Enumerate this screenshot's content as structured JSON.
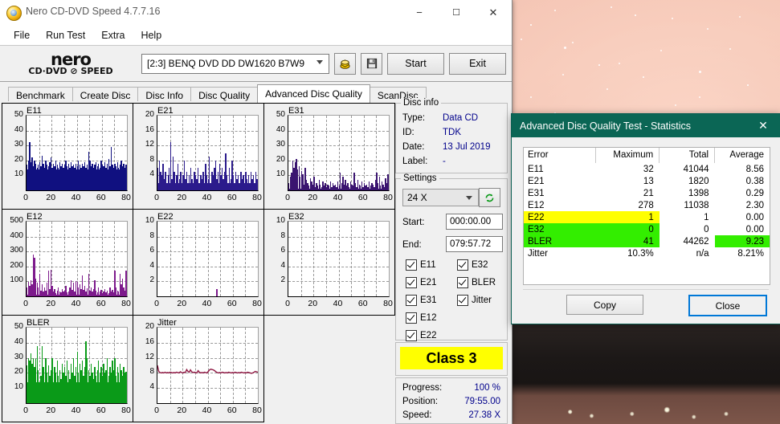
{
  "window": {
    "title": "Nero CD-DVD Speed 4.7.7.16",
    "icon": "nero-app-icon",
    "minimize": "−",
    "maximize": "☐",
    "close": "✕"
  },
  "menubar": {
    "items": [
      "File",
      "Run Test",
      "Extra",
      "Help"
    ]
  },
  "brand": {
    "line1": "nero",
    "line2": "CD·DVD ⊘ SPEED"
  },
  "toolbar": {
    "drive": "[2:3]   BENQ DVD DD DW1620 B7W9",
    "eject_icon": "eject-disc-icon",
    "save_icon": "floppy-save-icon",
    "start_label": "Start",
    "exit_label": "Exit"
  },
  "tabs": {
    "items": [
      "Benchmark",
      "Create Disc",
      "Disc Info",
      "Disc Quality",
      "Advanced Disc Quality",
      "ScanDisc"
    ],
    "active": "Advanced Disc Quality"
  },
  "disc_info": {
    "legend": "Disc info",
    "rows": [
      {
        "key": "Type:",
        "value": "Data CD"
      },
      {
        "key": "ID:",
        "value": "TDK"
      },
      {
        "key": "Date:",
        "value": "13 Jul 2019"
      },
      {
        "key": "Label:",
        "value": "-"
      }
    ]
  },
  "settings": {
    "legend": "Settings",
    "speed": "24 X",
    "refresh_icon": "refresh-icon",
    "start_label": "Start:",
    "start_value": "000:00.00",
    "end_label": "End:",
    "end_value": "079:57.72",
    "checkboxes_col1": [
      "E11",
      "E21",
      "E31",
      "E12",
      "E22"
    ],
    "checkboxes_col2": [
      "E32",
      "BLER",
      "Jitter"
    ]
  },
  "class_result": "Class 3",
  "progress": {
    "rows": [
      {
        "key": "Progress:",
        "value": "100 %"
      },
      {
        "key": "Position:",
        "value": "79:55.00"
      },
      {
        "key": "Speed:",
        "value": "27.38 X"
      }
    ]
  },
  "colors": {
    "e11": "#101080",
    "e21": "#2b1b8c",
    "e31": "#3a1470",
    "e12": "#7d1a8c",
    "e22": "#7d1a8c",
    "bler": "#0a9a18",
    "jitter": "#8e1742",
    "highlight_yellow": "#ffff00",
    "highlight_green": "#33ee00",
    "dialog_title": "#0b6655"
  },
  "statistics_dialog": {
    "title": "Advanced Disc Quality Test - Statistics",
    "close_icon": "close-icon",
    "columns": [
      "Error",
      "Maximum",
      "Total",
      "Average"
    ],
    "rows": [
      {
        "error": "E11",
        "maximum": "32",
        "total": "41044",
        "average": "8.56",
        "highlight": "none"
      },
      {
        "error": "E21",
        "maximum": "13",
        "total": "1820",
        "average": "0.38",
        "highlight": "none"
      },
      {
        "error": "E31",
        "maximum": "21",
        "total": "1398",
        "average": "0.29",
        "highlight": "none"
      },
      {
        "error": "E12",
        "maximum": "278",
        "total": "11038",
        "average": "2.30",
        "highlight": "none"
      },
      {
        "error": "E22",
        "maximum": "1",
        "total": "1",
        "average": "0.00",
        "highlight": "yellow"
      },
      {
        "error": "E32",
        "maximum": "0",
        "total": "0",
        "average": "0.00",
        "highlight": "green"
      },
      {
        "error": "BLER",
        "maximum": "41",
        "total": "44262",
        "average": "9.23",
        "highlight": "green-avg"
      },
      {
        "error": "Jitter",
        "maximum": "10.3%",
        "total": "n/a",
        "average": "8.21%",
        "highlight": "none"
      }
    ],
    "copy_label": "Copy",
    "close_label": "Close"
  },
  "chart_data": [
    {
      "type": "bar",
      "title": "E11",
      "ylabel": "",
      "xlabel": "",
      "ylim": [
        0,
        50
      ],
      "yticks": [
        10,
        20,
        30,
        40,
        50
      ],
      "xlim": [
        0,
        80
      ],
      "xticks": [
        0,
        20,
        40,
        60,
        80
      ],
      "grid": true,
      "color": "#101080",
      "baseline": 14,
      "values": [
        17,
        20,
        32,
        19,
        22,
        16,
        20,
        18,
        15,
        17,
        19,
        16,
        23,
        18,
        15,
        20,
        17,
        16,
        19,
        22,
        15,
        18,
        16,
        20,
        17,
        15,
        19,
        16,
        18,
        15,
        17,
        20,
        16,
        18,
        15,
        19,
        16,
        17,
        15,
        18,
        16,
        20,
        17,
        15,
        18,
        16,
        19,
        15,
        17,
        26,
        20,
        16,
        18,
        15,
        17,
        19,
        16,
        18,
        15,
        20,
        17,
        16,
        19,
        15,
        18,
        21,
        16,
        29,
        17,
        15,
        18,
        16,
        19,
        15,
        17,
        20,
        16,
        18,
        15,
        17
      ]
    },
    {
      "type": "bar",
      "title": "E21",
      "ylim": [
        0,
        20
      ],
      "yticks": [
        4,
        8,
        12,
        16,
        20
      ],
      "xlim": [
        0,
        80
      ],
      "xticks": [
        0,
        20,
        40,
        60,
        80
      ],
      "grid": true,
      "color": "#2b1b8c",
      "baseline": 2,
      "values": [
        6,
        8,
        5,
        4,
        7,
        3,
        5,
        2,
        4,
        6,
        13,
        3,
        9,
        5,
        2,
        4,
        7,
        3,
        5,
        2,
        4,
        8,
        3,
        5,
        2,
        4,
        6,
        3,
        2,
        5,
        4,
        3,
        6,
        2,
        4,
        3,
        5,
        2,
        7,
        4,
        3,
        9,
        2,
        5,
        4,
        6,
        8,
        3,
        5,
        7,
        4,
        6,
        3,
        5,
        10,
        4,
        2,
        6,
        3,
        8,
        4,
        2,
        5,
        3,
        4,
        2,
        5,
        3,
        4,
        2,
        5,
        3,
        4,
        2,
        5,
        3,
        4,
        2,
        5,
        3
      ]
    },
    {
      "type": "bar",
      "title": "E31",
      "ylim": [
        0,
        50
      ],
      "yticks": [
        10,
        20,
        30,
        40,
        50
      ],
      "xlim": [
        0,
        80
      ],
      "xticks": [
        0,
        20,
        40,
        60,
        80
      ],
      "grid": true,
      "color": "#3a1470",
      "baseline": 1,
      "values": [
        5,
        9,
        12,
        20,
        15,
        19,
        21,
        14,
        16,
        9,
        13,
        11,
        4,
        15,
        7,
        5,
        3,
        8,
        6,
        4,
        9,
        2,
        5,
        3,
        7,
        4,
        2,
        6,
        3,
        5,
        2,
        4,
        3,
        6,
        2,
        5,
        3,
        4,
        2,
        6,
        3,
        12,
        5,
        9,
        4,
        7,
        3,
        5,
        2,
        6,
        4,
        3,
        12,
        5,
        2,
        7,
        4,
        3,
        6,
        2,
        5,
        3,
        4,
        2,
        6,
        3,
        5,
        4,
        2,
        7,
        12,
        5,
        9,
        3,
        6,
        4,
        2,
        8,
        5,
        11
      ]
    },
    {
      "type": "bar",
      "title": "E12",
      "ylim": [
        0,
        500
      ],
      "yticks": [
        100,
        200,
        300,
        400,
        500
      ],
      "xlim": [
        0,
        80
      ],
      "xticks": [
        0,
        20,
        40,
        60,
        80
      ],
      "grid": true,
      "color": "#7d1a8c",
      "baseline": 10,
      "values": [
        60,
        95,
        70,
        110,
        80,
        278,
        260,
        120,
        90,
        60,
        150,
        40,
        80,
        30,
        60,
        40,
        90,
        170,
        50,
        175,
        70,
        30,
        50,
        20,
        40,
        60,
        35,
        25,
        50,
        30,
        40,
        70,
        25,
        35,
        60,
        110,
        45,
        90,
        30,
        100,
        95,
        60,
        80,
        50,
        140,
        45,
        70,
        30,
        55,
        150,
        40,
        60,
        30,
        50,
        110,
        40,
        25,
        60,
        30,
        45,
        20,
        35,
        50,
        25,
        40,
        20,
        60,
        30,
        45,
        25,
        170,
        60,
        40,
        30,
        150,
        80,
        120,
        60,
        40,
        170
      ]
    },
    {
      "type": "bar",
      "title": "E22",
      "ylim": [
        0,
        10
      ],
      "yticks": [
        2,
        4,
        6,
        8,
        10
      ],
      "xlim": [
        0,
        80
      ],
      "xticks": [
        0,
        20,
        40,
        60,
        80
      ],
      "grid": true,
      "color": "#7d1a8c",
      "baseline": 0,
      "values": [
        0,
        0,
        0,
        0,
        0,
        0,
        0,
        0,
        0,
        0,
        0,
        0,
        0,
        0,
        0,
        0,
        0,
        0,
        0,
        0,
        0,
        0,
        0,
        0,
        0,
        0,
        0,
        0,
        0,
        0,
        0,
        0,
        0,
        0,
        0,
        0,
        0,
        0,
        0,
        0,
        0,
        0,
        0,
        0,
        0,
        0,
        0,
        1,
        0,
        0,
        0,
        0,
        0,
        0,
        0,
        0,
        0,
        0,
        0,
        0,
        0,
        0,
        0,
        0,
        0,
        0,
        0,
        0,
        0,
        0,
        0,
        0,
        0,
        0,
        0,
        0,
        0,
        0,
        0,
        0
      ]
    },
    {
      "type": "bar",
      "title": "E32",
      "ylim": [
        0,
        10
      ],
      "yticks": [
        2,
        4,
        6,
        8,
        10
      ],
      "xlim": [
        0,
        80
      ],
      "xticks": [
        0,
        20,
        40,
        60,
        80
      ],
      "grid": true,
      "color": "#7d1a8c",
      "baseline": 0,
      "values": [
        0,
        0,
        0,
        0,
        0,
        0,
        0,
        0,
        0,
        0,
        0,
        0,
        0,
        0,
        0,
        0,
        0,
        0,
        0,
        0,
        0,
        0,
        0,
        0,
        0,
        0,
        0,
        0,
        0,
        0,
        0,
        0,
        0,
        0,
        0,
        0,
        0,
        0,
        0,
        0,
        0,
        0,
        0,
        0,
        0,
        0,
        0,
        0,
        0,
        0,
        0,
        0,
        0,
        0,
        0,
        0,
        0,
        0,
        0,
        0,
        0,
        0,
        0,
        0,
        0,
        0,
        0,
        0,
        0,
        0,
        0,
        0,
        0,
        0,
        0,
        0,
        0,
        0,
        0,
        0
      ]
    },
    {
      "type": "bar",
      "title": "BLER",
      "ylim": [
        0,
        50
      ],
      "yticks": [
        10,
        20,
        30,
        40,
        50
      ],
      "xlim": [
        0,
        80
      ],
      "xticks": [
        0,
        20,
        40,
        60,
        80
      ],
      "grid": true,
      "color": "#0a9a18",
      "baseline": 14,
      "values": [
        25,
        30,
        28,
        33,
        26,
        30,
        24,
        29,
        38,
        22,
        12,
        18,
        38,
        24,
        12,
        30,
        20,
        25,
        18,
        22,
        30,
        14,
        24,
        20,
        28,
        18,
        22,
        16,
        26,
        20,
        24,
        18,
        28,
        22,
        16,
        26,
        20,
        30,
        18,
        24,
        34,
        20,
        26,
        22,
        28,
        18,
        24,
        41,
        30,
        22,
        18,
        26,
        20,
        16,
        24,
        18,
        22,
        28,
        20,
        24,
        18,
        26,
        20,
        22,
        30,
        18,
        24,
        20,
        28,
        22,
        30,
        18,
        24,
        20,
        26,
        22,
        18,
        24,
        20,
        21
      ]
    },
    {
      "type": "line",
      "title": "Jitter",
      "ylim": [
        0,
        20
      ],
      "yticks": [
        4,
        8,
        12,
        16,
        20
      ],
      "xlim": [
        0,
        80
      ],
      "xticks": [
        0,
        20,
        40,
        60,
        80
      ],
      "grid": true,
      "color": "#8e1742",
      "values": [
        10,
        8.4,
        8.1,
        8.0,
        8.1,
        8.0,
        8.2,
        8.0,
        8.1,
        8.0,
        8.2,
        8.1,
        8.0,
        8.1,
        8.0,
        8.2,
        8.1,
        8.0,
        8.3,
        8.1,
        8.0,
        8.2,
        8.1,
        8.9,
        8.4,
        8.2,
        8.8,
        8.3,
        8.1,
        8.2,
        8.1,
        8.0,
        8.6,
        8.2,
        8.0,
        8.1,
        8.0,
        8.2,
        8.1,
        8.0,
        8.4,
        8.8,
        9.0,
        8.9,
        8.8,
        8.6,
        8.3,
        8.1,
        8.0,
        8.1,
        8.0,
        8.2,
        8.1,
        8.0,
        8.1,
        8.0,
        8.2,
        8.1,
        8.0,
        8.1,
        8.0,
        8.2,
        8.1,
        8.0,
        8.1,
        8.0,
        8.2,
        8.1,
        8.0,
        8.1,
        8.0,
        8.2,
        8.1,
        8.0,
        7.9,
        8.0,
        8.2,
        8.4,
        8.3,
        8.2
      ]
    }
  ]
}
